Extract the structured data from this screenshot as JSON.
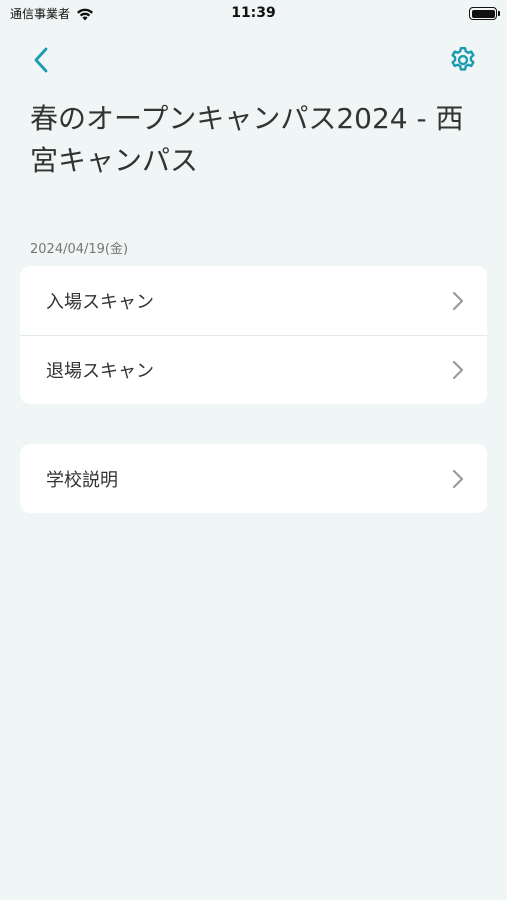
{
  "status_bar": {
    "carrier": "通信事業者",
    "time": "11:39"
  },
  "nav": {
    "back_icon": "chevron-left-icon",
    "settings_icon": "gear-icon",
    "accent_color": "#1a9bb0"
  },
  "event": {
    "title": "春のオープンキャンパス2024 - 西宮キャンパス",
    "date": "2024/04/19(金)"
  },
  "scan_menu": {
    "items": [
      {
        "label": "入場スキャン",
        "icon": "chevron-right-icon"
      },
      {
        "label": "退場スキャン",
        "icon": "chevron-right-icon"
      }
    ]
  },
  "info_menu": {
    "items": [
      {
        "label": "学校説明",
        "icon": "chevron-right-icon"
      }
    ]
  }
}
